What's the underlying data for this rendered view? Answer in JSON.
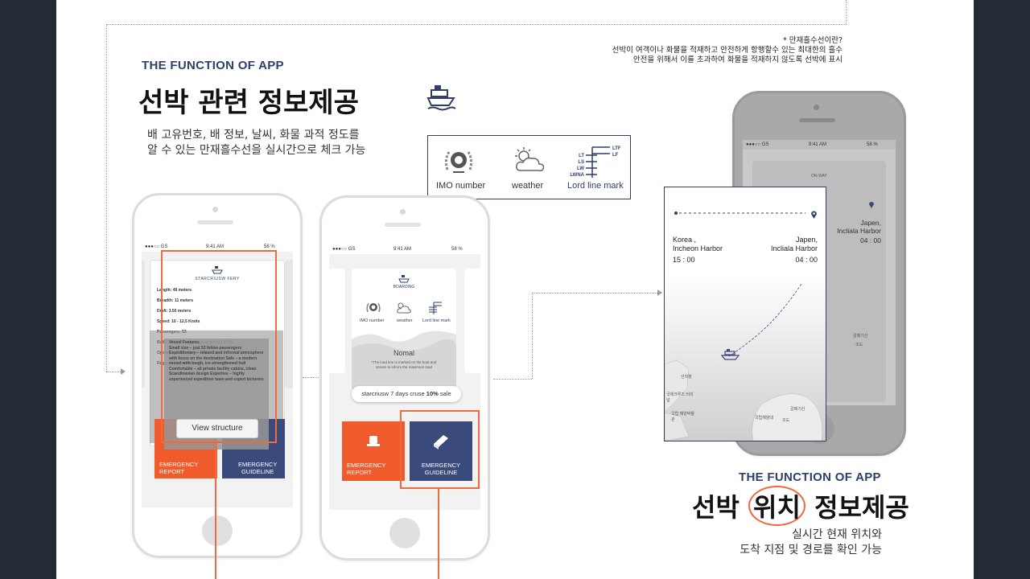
{
  "section1": {
    "eyebrow": "THE FUNCTION OF APP",
    "title": "선박 관련 정보제공",
    "desc_line1": "배 고유번호, 배 정보, 날씨, 화물 과적 정도를",
    "desc_line2": "알 수 있는 만재흘수선을 실시간으로 체크 가능"
  },
  "note": {
    "line1": "* 만재흘수선이란?",
    "line2": "선박이 여객이나 화물을 적재하고 안전하게 항행할수 있는 최대한의 흘수",
    "line3": "안전을 위해서 이를 초과하여 화물을 적재하지 않도록 선박에 표시"
  },
  "legend": {
    "imo": "IMO number",
    "weather": "weather",
    "lord": "Lord line mark",
    "marks_left": [
      "LT",
      "LS",
      "LW",
      "LWNA"
    ],
    "marks_right": [
      "LTF",
      "LF"
    ]
  },
  "phone_status": {
    "carrier": "●●●○○ GS",
    "time": "9:41 AM",
    "battery": "58 %"
  },
  "phone1": {
    "brand": "STARCRIUSW FERY",
    "specs": [
      "Length: 49 meters",
      "Breadth: 11 meters",
      "Draft: 3.50 meters",
      "Speed: 10 - 12,5 Knots",
      "Passengers: 53",
      "Built: 1992, Denmark - refurbished 2005",
      "Operator: Polar Quest Expeditions",
      "Registry: Bahamas"
    ],
    "features_title": "Vessel Features",
    "features": "Small size – just 53 fellow passengers Expeditionary – relaxed and informal atmosphere with focus on the destination Safe – a modern vessel with tough, ice-strengthened hull Comfortable – all private facility cabins, clean Scandinavian design Expertise – highly experienced expedition team and expert lecturers",
    "view_button": "View structure",
    "emergency_report": "EMERGENCY\nREPORT",
    "emergency_guideline": "EMERGENCY\nGUIDELINE"
  },
  "phone2": {
    "brand": "BOARDING",
    "imo": "IMO number",
    "weather": "weather",
    "lord": "Lord line mark",
    "status": "Nomal",
    "status_note": "*The load line is marked on the boat and serves to inform the maximum load",
    "promo": "starcriusw 7 days cruse 10% sale",
    "promo_strong": "10%",
    "emergency_report_1": "EMERGENCY",
    "emergency_report_2": "REPORT",
    "emergency_guideline_1": "EMERGENCY",
    "emergency_guideline_2": "GUIDELINE"
  },
  "map": {
    "from_label": "Korea ,",
    "from_place": "Incheon Harbor",
    "from_time": "15 : 00",
    "to_label": "Japen,",
    "to_place": "Incliala Harbor",
    "to_time": "04 : 00",
    "back_brand": "ON WAY",
    "places": [
      "선착장",
      "국제크루즈 터미널",
      "국립 해양박물관",
      "갈매기산",
      "조도",
      "국립해양대",
      "갈매기산",
      "조도"
    ]
  },
  "section2": {
    "eyebrow": "THE FUNCTION OF APP",
    "title_pre": "선박",
    "title_circle": "위치",
    "title_post": "정보제공",
    "desc_line1": "실시간 현재 위치와",
    "desc_line2": "도착 지점 및 경로를 확인 가능"
  },
  "colors": {
    "navy": "#2f3f6b",
    "orange": "#ef6a3e",
    "report_orange": "#f15a2b",
    "guideline_navy": "#3a4a7a"
  }
}
